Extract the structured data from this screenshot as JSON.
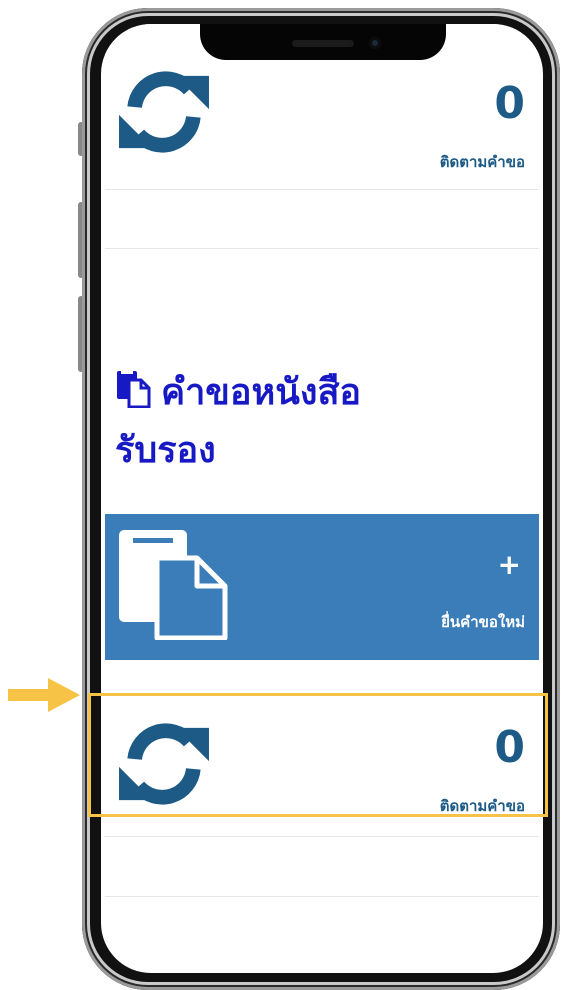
{
  "top_card": {
    "count": "0",
    "label": "ติดตามคำขอ"
  },
  "section": {
    "title_line1": "คำขอหนังสือ",
    "title_line2": "รับรอง"
  },
  "new_request": {
    "plus": "+",
    "label": "ยื่นคำขอใหม่"
  },
  "tracking_card": {
    "count": "0",
    "label": "ติดตามคำขอ"
  },
  "icons": {
    "sync": "sync-icon",
    "document": "document-copy-icon",
    "pointer": "arrow-right-icon"
  },
  "colors": {
    "accent_blue": "#3b7db8",
    "title_blue": "#1719c4",
    "icon_blue": "#1d5a86",
    "highlight": "#f7c347"
  }
}
